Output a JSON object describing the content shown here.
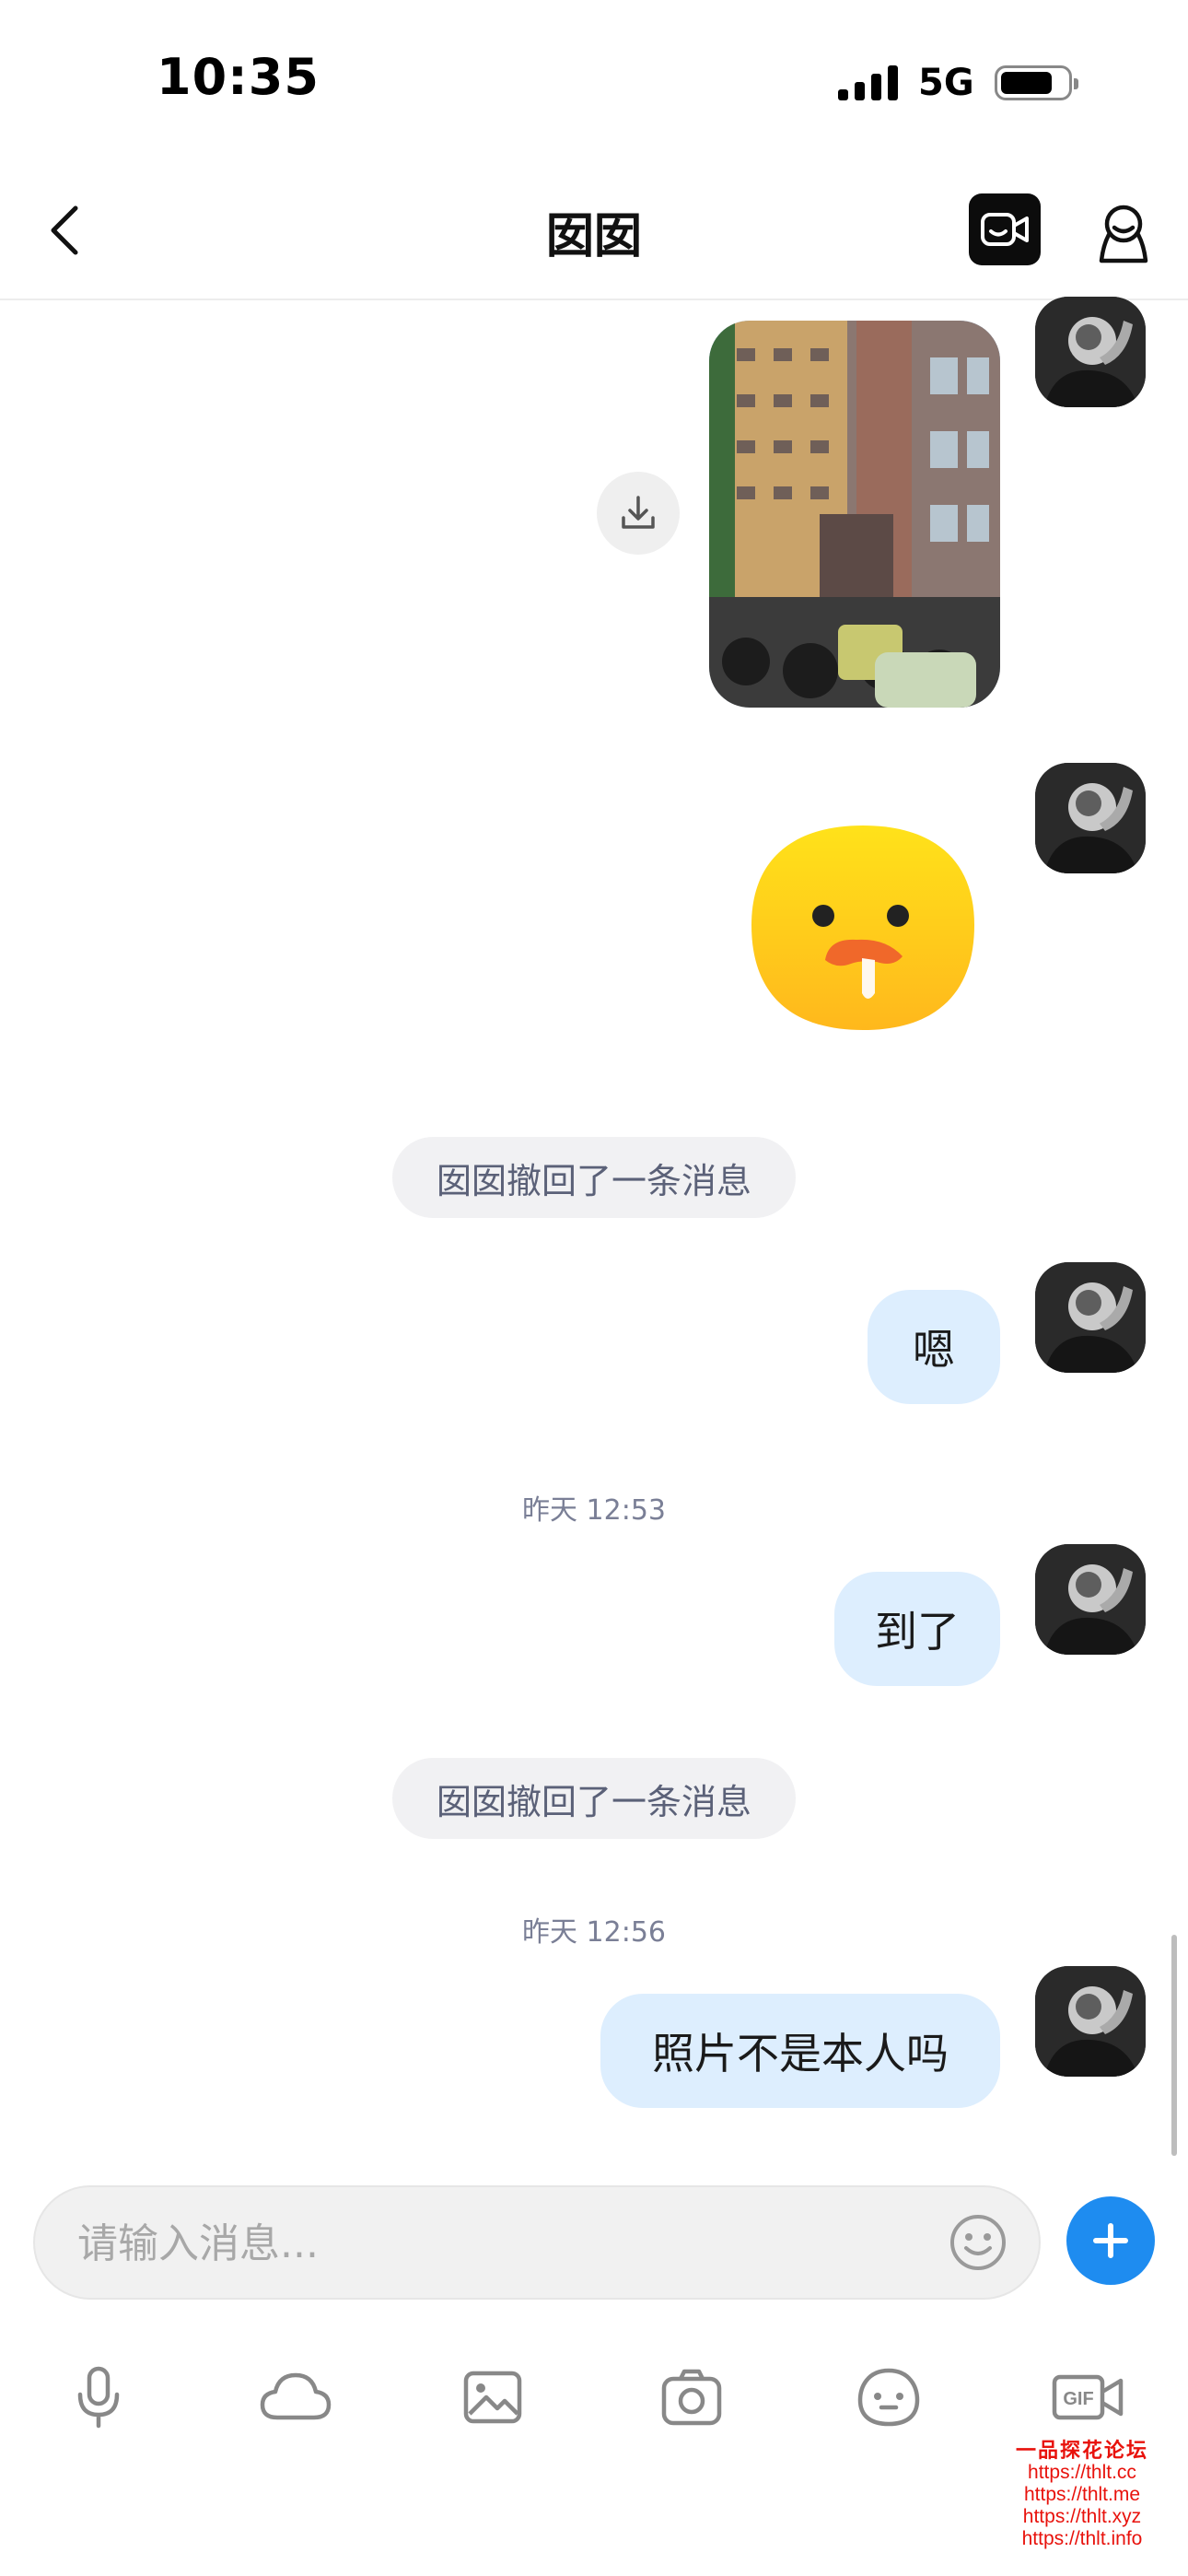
{
  "status_bar": {
    "time": "10:35",
    "network": "5G",
    "battery_level": 0.8,
    "signal_bars": 4
  },
  "nav": {
    "title": "囡囡",
    "back_icon": "chevron-left-icon",
    "video_icon": "video-camera-icon",
    "profile_icon": "person-icon"
  },
  "messages": [
    {
      "type": "image",
      "direction": "sent",
      "action_icon": "download-icon"
    },
    {
      "type": "sticker",
      "direction": "sent",
      "sticker": "drooling-yellow-face"
    },
    {
      "type": "system",
      "text": "囡囡撤回了一条消息"
    },
    {
      "type": "text",
      "direction": "sent",
      "text": "嗯"
    },
    {
      "type": "timestamp",
      "text": "昨天 12:53"
    },
    {
      "type": "text",
      "direction": "sent",
      "text": "到了"
    },
    {
      "type": "system",
      "text": "囡囡撤回了一条消息"
    },
    {
      "type": "timestamp",
      "text": "昨天 12:56"
    },
    {
      "type": "text",
      "direction": "sent",
      "text": "照片不是本人吗"
    }
  ],
  "input": {
    "placeholder": "请输入消息...",
    "value": "",
    "emoji_icon": "emoji-icon",
    "add_icon": "plus-icon"
  },
  "toolbar": [
    {
      "icon": "microphone-icon"
    },
    {
      "icon": "cloud-icon"
    },
    {
      "icon": "image-icon"
    },
    {
      "icon": "camera-icon"
    },
    {
      "icon": "sticker-face-icon"
    },
    {
      "icon": "gif-icon",
      "label": "GIF"
    }
  ],
  "watermark": {
    "title": "一品探花论坛",
    "lines": [
      "https://thlt.cc",
      "https://thlt.me",
      "https://thlt.xyz",
      "https://thlt.info"
    ]
  },
  "colors": {
    "accent": "#1e8cf0",
    "sent_bubble": "#ddeefe",
    "system_bubble": "#f1f1f3",
    "watermark": "#e8120c"
  }
}
